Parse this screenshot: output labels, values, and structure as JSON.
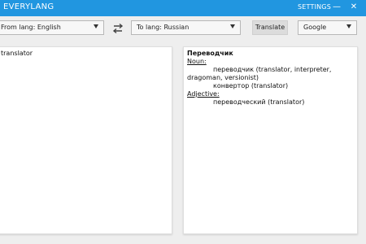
{
  "window": {
    "title": "EVERYLANG",
    "settings_label": "SETTINGS",
    "minimize_glyph": "—",
    "close_glyph": "✕"
  },
  "toolbar": {
    "from_lang": "From lang: English",
    "to_lang": "To lang: Russian",
    "translate_label": "Translate",
    "engine": "Google"
  },
  "source": {
    "text": "translator"
  },
  "result": {
    "headword": "Переводчик",
    "groups": [
      {
        "pos": "Noun:",
        "entries": [
          "переводчик (translator, interpreter, dragoman, versionist)",
          "конвертор (translator)"
        ]
      },
      {
        "pos": "Adjective:",
        "entries": [
          "переводческий (translator)"
        ]
      }
    ]
  },
  "colors": {
    "titlebar": "#2196e0",
    "background": "#eeeeee",
    "pane": "#ffffff"
  },
  "icons": {
    "swap": "swap-arrows-icon",
    "dropdown": "chevron-down-icon"
  }
}
